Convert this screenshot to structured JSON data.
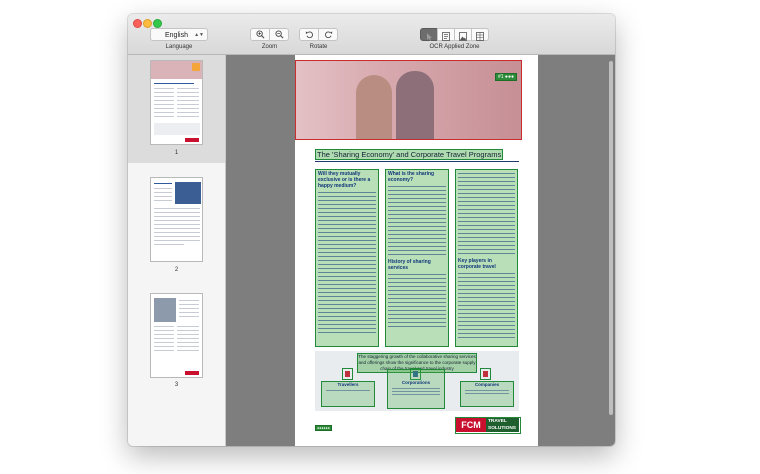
{
  "toolbar": {
    "language_value": "English",
    "language_label": "Language",
    "zoom_label": "Zoom",
    "rotate_label": "Rotate",
    "ocr_applied_zone_label": "OCR Applied Zone"
  },
  "sidebar": {
    "pages": [
      {
        "number": "1",
        "selected": true
      },
      {
        "number": "2",
        "selected": false
      },
      {
        "number": "3",
        "selected": false
      }
    ]
  },
  "document": {
    "title": "The 'Sharing Economy' and Corporate Travel Programs",
    "col1_heading": "Will they mutually exclusive or is there a happy medium?",
    "col2_heading": "What is the sharing economy?",
    "col2_subheading": "History of sharing services",
    "col3_subheading": "Key players in corporate travel",
    "infobox_heading": "The staggering growth of the collaborative sharing services and offerings show the significance to the corporate supply chain of the travel and travel industry",
    "info_cards": [
      "Travellers",
      "Corporations",
      "Companies"
    ],
    "logo_fcm": "FCM",
    "logo_travel": "TRAVEL",
    "logo_solutions": "SOLUTIONS"
  },
  "colors": {
    "ocr_zone_green": "#22883a",
    "ocr_zone_red": "#c72d2d",
    "active_button": "#6d6d6d",
    "fcm_red": "#c8102e",
    "travel_green": "#1f5f2d"
  }
}
